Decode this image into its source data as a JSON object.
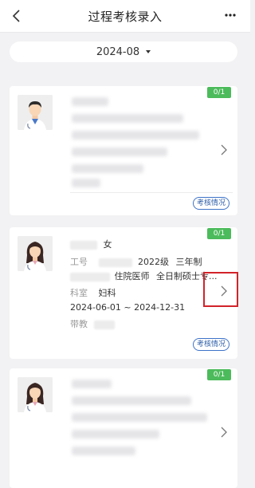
{
  "header": {
    "title": "过程考核录入",
    "back_icon": "chevron-left-icon",
    "more_icon": "more-dots-icon"
  },
  "filter": {
    "month": "2024-08",
    "caret_icon": "caret-down-icon"
  },
  "records": [
    {
      "score": "0/1",
      "avatar": "male-doctor-avatar",
      "review_label": "考核情况"
    },
    {
      "score": "0/1",
      "avatar": "female-doctor-avatar",
      "gender": "女",
      "id_label": "工号",
      "grade": "2022级",
      "program": "三年制",
      "role": "住院医师",
      "degree": "全日制硕士专...",
      "dept_label": "科室",
      "dept": "妇科",
      "period": "2024-06-01 ~ 2024-12-31",
      "mentor_label": "带教",
      "review_label": "考核情况"
    },
    {
      "score": "0/1",
      "avatar": "female-doctor-avatar"
    }
  ],
  "colors": {
    "badge_green": "#4cbb5b",
    "tag_blue": "#3d73c8",
    "highlight_red": "#d2232a"
  }
}
